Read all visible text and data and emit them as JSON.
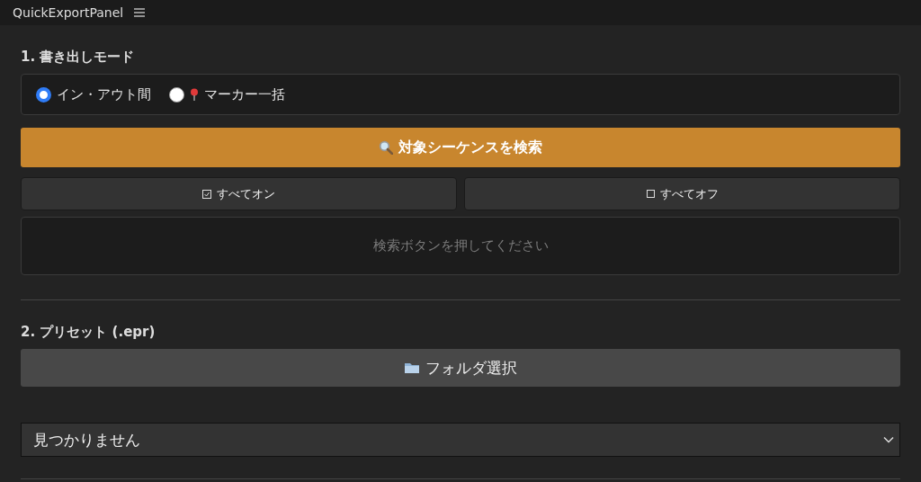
{
  "panel": {
    "title": "QuickExportPanel"
  },
  "mode_section": {
    "heading": "1. 書き出しモード",
    "options": [
      {
        "label": "イン・アウト間",
        "selected": true,
        "kind": "plain"
      },
      {
        "label": "マーカー一括",
        "selected": false,
        "kind": "marker"
      }
    ],
    "search_button": "対象シーケンスを検索",
    "all_on_button": "すべてオン",
    "all_off_button": "すべてオフ",
    "results_message": "検索ボタンを押してください"
  },
  "preset_section": {
    "heading": "2. プリセット (.epr)",
    "folder_button": "フォルダ選択",
    "preset_select": {
      "value": "見つかりません"
    }
  }
}
